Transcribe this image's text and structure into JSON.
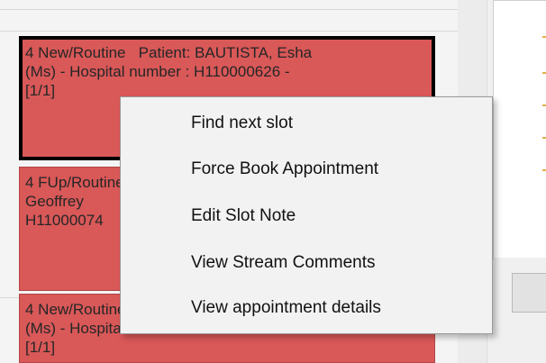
{
  "calendar": {
    "slots": [
      {
        "text": "4 New/Routine   Patient: BAUTISTA, Esha\n(Ms) - Hospital number : H110000626 -\n[1/1]"
      },
      {
        "text": "4 FUp/Routine   Patient: \nGeoffrey\nH11000074"
      },
      {
        "text": "4 New/Routine   Patient: \n(Ms) - Hospital number : H110000650 -\n[1/1]"
      }
    ]
  },
  "context_menu": {
    "items": [
      {
        "label": "Find next slot"
      },
      {
        "label": "Force Book Appointment"
      },
      {
        "label": "Edit Slot Note"
      },
      {
        "label": "View Stream Comments"
      },
      {
        "label": "View appointment details"
      }
    ]
  },
  "colors": {
    "slot_fill": "#d95858",
    "slot_selected_border": "#000000",
    "menu_background": "#f2f2f2"
  }
}
